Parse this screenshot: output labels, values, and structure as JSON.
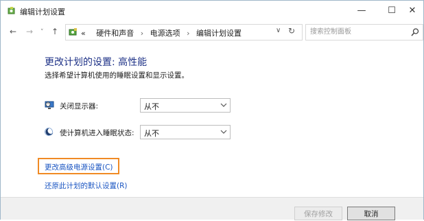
{
  "window": {
    "title": "编辑计划设置",
    "controls": {
      "minimize": "—",
      "maximize": "☐",
      "close": "✕"
    }
  },
  "nav": {
    "back": "←",
    "forward": "→",
    "recent": "˅",
    "up": "↑",
    "breadcrumbs": [
      "«",
      "硬件和声音",
      "›",
      "电源选项",
      "›",
      "编辑计划设置"
    ],
    "dropdown": "∨",
    "refresh": "↻",
    "search_placeholder": "搜索控制面板"
  },
  "main": {
    "heading": "更改计划的设置: 高性能",
    "subtitle": "选择希望计算机使用的睡眠设置和显示设置。",
    "rows": [
      {
        "label": "关闭显示器:",
        "value": "从不",
        "icon": "display-timer-icon"
      },
      {
        "label": "使计算机进入睡眠状态:",
        "value": "从不",
        "icon": "sleep-moon-icon"
      }
    ],
    "links": {
      "advanced": "更改高级电源设置(C)",
      "restore": "还原此计划的默认设置(R)"
    }
  },
  "footer": {
    "save": "保存修改",
    "cancel": "取消"
  },
  "colors": {
    "heading": "#1e3287",
    "link": "#1a55c2",
    "highlight": "#f08a24"
  }
}
